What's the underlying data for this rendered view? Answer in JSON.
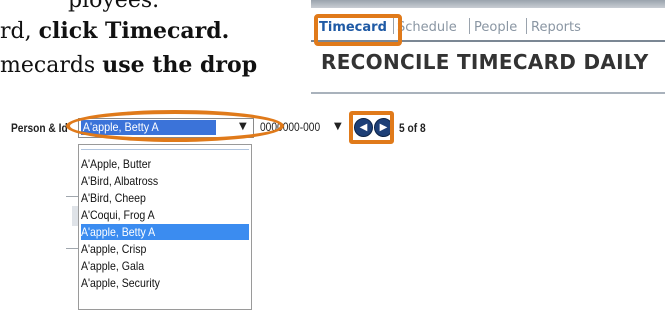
{
  "doc": {
    "line1": "ployees.",
    "line2_pre": "rd, ",
    "line2_bold": "click Timecard.",
    "line3_pre": "mecards ",
    "line3_bold": "use the drop"
  },
  "app": {
    "tabs": [
      {
        "label": "Timecard",
        "active": true
      },
      {
        "label": "Schedule",
        "active": false
      },
      {
        "label": "People",
        "active": false
      },
      {
        "label": "Reports",
        "active": false
      }
    ],
    "heading": "RECONCILE TIMECARD DAILY"
  },
  "person_row": {
    "label": "Person & Id",
    "selected_person": "A'apple, Betty A",
    "id_value": "0000000-000",
    "count": "5 of 8"
  },
  "dropdown": {
    "items": [
      {
        "label": "A'Apple, Butter",
        "selected": false
      },
      {
        "label": "A'Bird, Albatross",
        "selected": false
      },
      {
        "label": "A'Bird, Cheep",
        "selected": false
      },
      {
        "label": "A'Coqui, Frog A",
        "selected": false
      },
      {
        "label": "A'apple, Betty A",
        "selected": true
      },
      {
        "label": "A'apple, Crisp",
        "selected": false
      },
      {
        "label": "A'apple, Gala",
        "selected": false
      },
      {
        "label": "A'apple, Security",
        "selected": false
      }
    ]
  },
  "colors": {
    "highlight": "#e07a1a",
    "tab_active": "#1f5aa5",
    "selection": "#3b8cf0"
  }
}
